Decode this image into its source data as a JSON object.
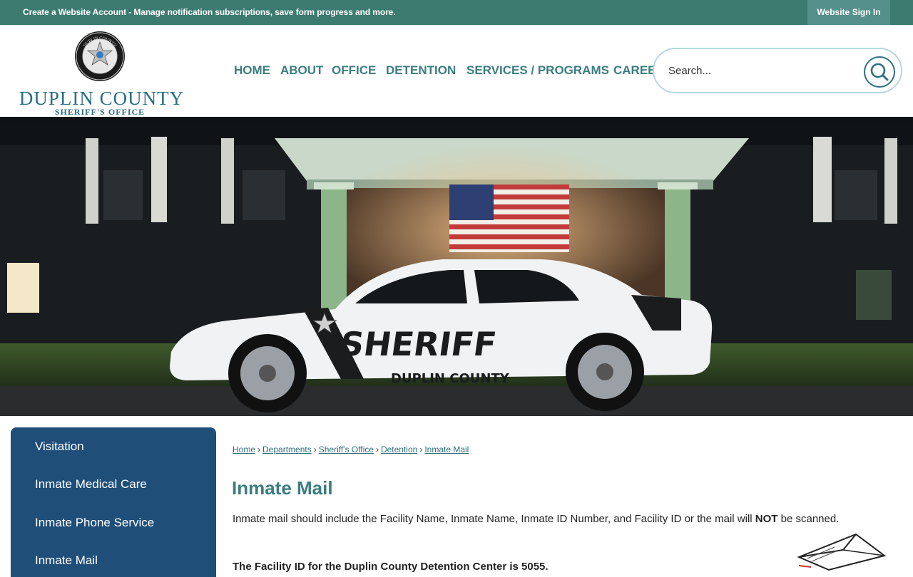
{
  "topbar": {
    "account_link": "Create a Website Account",
    "account_desc": " - Manage notification subscriptions, save form progress and more.",
    "signin": "Website Sign In"
  },
  "logo": {
    "name": "DUPLIN COUNTY",
    "subtitle": "SHERIFF'S OFFICE",
    "seal_ring_top": "DUPLIN COUNTY",
    "seal_ring_bottom": "SHERIFF'S OFFICE"
  },
  "nav": {
    "items": [
      {
        "label": "HOME"
      },
      {
        "label": "ABOUT"
      },
      {
        "label": "OFFICE"
      },
      {
        "label": "DETENTION"
      },
      {
        "label": "SERVICES / PROGRAMS"
      },
      {
        "label": "CAREERS"
      }
    ]
  },
  "search": {
    "placeholder": "Search...",
    "icon": "search-icon"
  },
  "hero": {
    "car_text": "SHERIFF",
    "car_subtext": "DUPLIN COUNTY"
  },
  "sidebar": {
    "items": [
      {
        "label": "Visitation"
      },
      {
        "label": "Inmate Medical Care"
      },
      {
        "label": "Inmate Phone Service"
      },
      {
        "label": "Inmate Mail"
      }
    ]
  },
  "breadcrumb": {
    "items": [
      {
        "label": "Home"
      },
      {
        "label": "Departments"
      },
      {
        "label": "Sheriff's Office"
      },
      {
        "label": "Detention"
      },
      {
        "label": "Inmate Mail"
      }
    ],
    "separator": "›"
  },
  "content": {
    "title": "Inmate Mail",
    "para_before": "Inmate mail should include the Facility Name, Inmate Name, Inmate ID Number, and Facility ID or the mail will ",
    "para_bold": "NOT",
    "para_after": " be scanned.",
    "facility_line": "The Facility ID for the Duplin County Detention Center is 5055."
  },
  "colors": {
    "topbar": "#3d7b70",
    "nav_text": "#3b7d80",
    "sidebar": "#1f4e79",
    "logo_text": "#2b6e8a"
  }
}
